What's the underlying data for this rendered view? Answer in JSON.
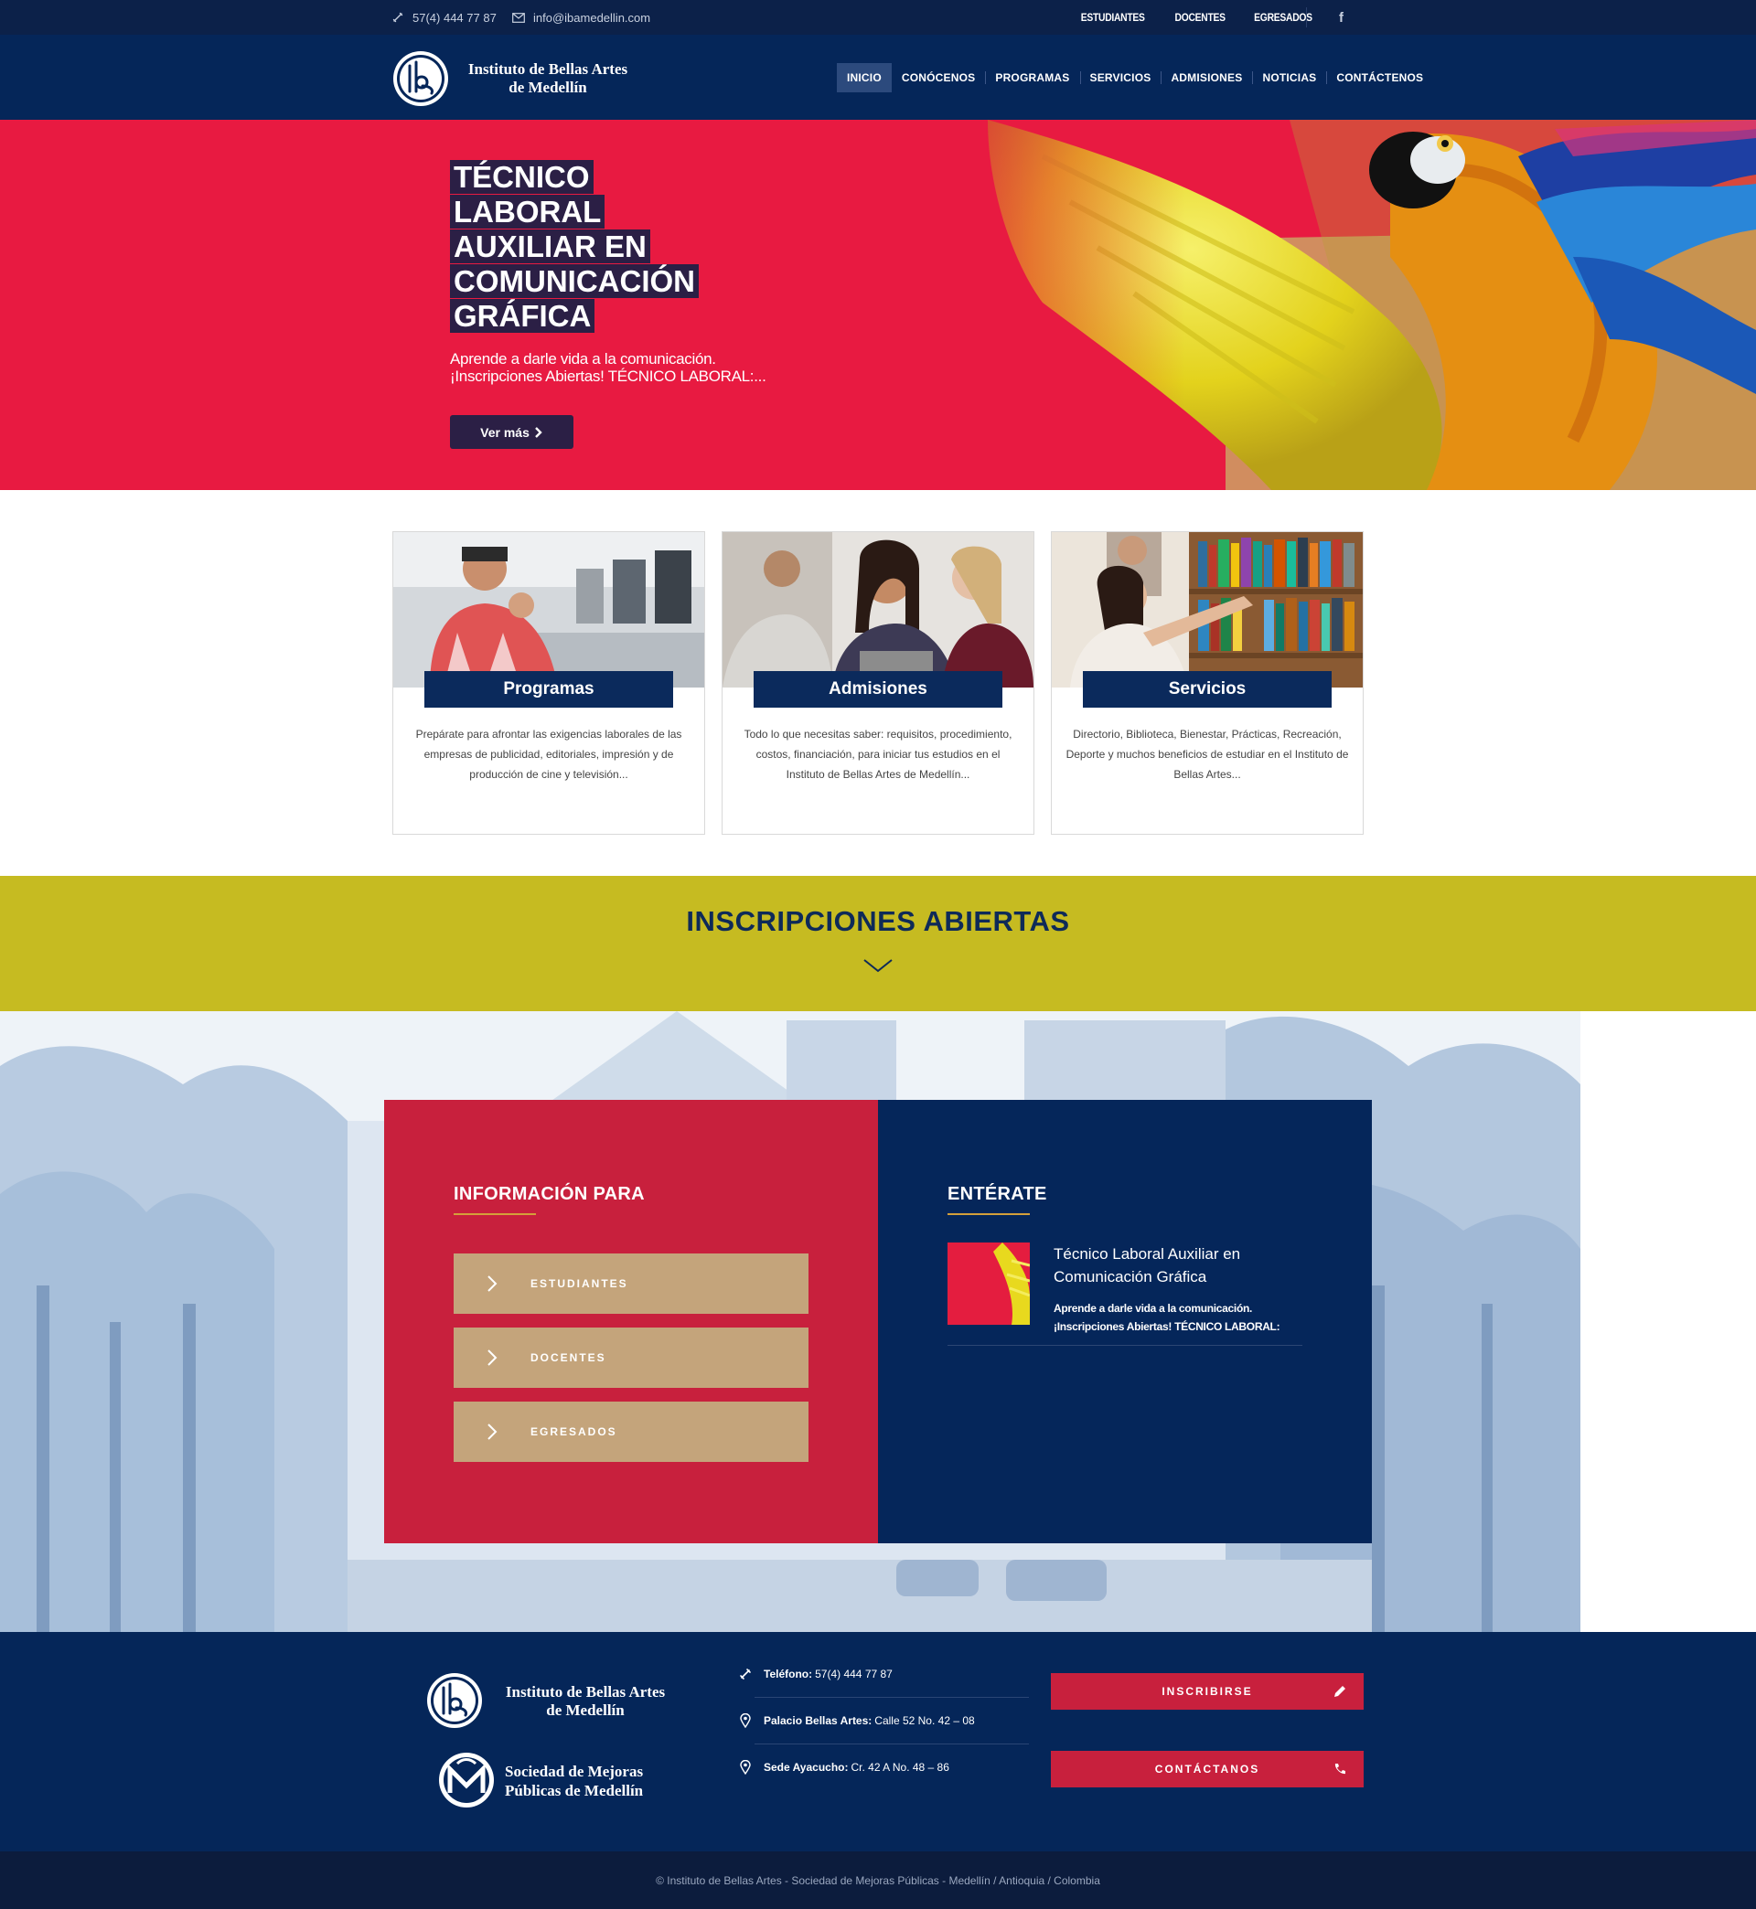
{
  "topbar": {
    "phone": "57(4) 444 77 87",
    "email": "info@ibamedellin.com",
    "links": [
      "ESTUDIANTES",
      "DOCENTES",
      "EGRESADOS"
    ],
    "facebook": "f"
  },
  "header": {
    "brand_line1": "Instituto de Bellas Artes",
    "brand_line2": "de Medellín",
    "nav": [
      "INICIO",
      "CONÓCENOS",
      "PROGRAMAS",
      "SERVICIOS",
      "ADMISIONES",
      "NOTICIAS",
      "CONTÁCTENOS"
    ],
    "active_nav": "INICIO"
  },
  "hero": {
    "title_lines": [
      "TÉCNICO",
      "LABORAL",
      "AUXILIAR EN",
      "COMUNICACIÓN",
      "GRÁFICA"
    ],
    "subtitle_line1": "Aprende a darle vida a la comunicación.",
    "subtitle_line2": "¡Inscripciones Abiertas! TÉCNICO LABORAL:...",
    "button": "Ver más"
  },
  "cards": [
    {
      "title": "Programas",
      "text": "Prepárate para afrontar las exigencias laborales de las empresas de publicidad, editoriales, impresión y de producción de cine y televisión..."
    },
    {
      "title": "Admisiones",
      "text": "Todo lo que necesitas saber: requisitos, procedimiento, costos, financiación, para iniciar tus estudios en el Instituto de Bellas Artes de Medellín..."
    },
    {
      "title": "Servicios",
      "text": "Directorio, Biblioteca, Bienestar, Prácticas, Recreación, Deporte y muchos beneficios de estudiar en el Instituto de Bellas Artes..."
    }
  ],
  "banner": {
    "title": "INSCRIPCIONES ABIERTAS"
  },
  "info": {
    "title": "INFORMACIÓN PARA",
    "buttons": [
      "ESTUDIANTES",
      "DOCENTES",
      "EGRESADOS"
    ]
  },
  "news": {
    "title": "ENTÉRATE",
    "item_title": "Técnico Laboral Auxiliar en Comunicación Gráfica",
    "item_desc_line1": "Aprende a darle vida a la comunicación.",
    "item_desc_line2": "¡Inscripciones Abiertas! TÉCNICO LABORAL:"
  },
  "footer": {
    "brand1_line1": "Instituto de Bellas Artes",
    "brand1_line2": "de Medellín",
    "brand2_line1": "Sociedad de Mejoras",
    "brand2_line2": "Públicas de Medellín",
    "phone_label": "Teléfono:",
    "phone_value": "57(4) 444 77 87",
    "address1_label": "Palacio Bellas Artes:",
    "address1_value": "Calle 52 No. 42 – 08",
    "address2_label": "Sede Ayacucho:",
    "address2_value": "Cr. 42 A No. 48 – 86",
    "btn_register": "INSCRIBIRSE",
    "btn_contact": "CONTÁCTANOS"
  },
  "copyright": "© Instituto de Bellas Artes - Sociedad de Mejoras Públicas - Medellín / Antioquia / Colombia",
  "colors": {
    "navy": "#052659",
    "hero_red": "#e81a41",
    "band_olive": "#c6bb21",
    "info_red": "#c8203d",
    "info_button": "#c4a47b",
    "hero_button": "#2b1f45"
  }
}
